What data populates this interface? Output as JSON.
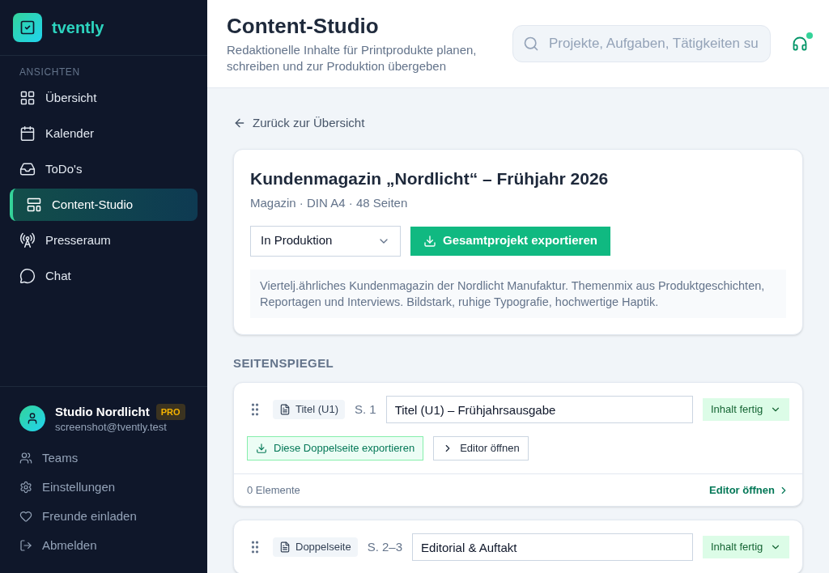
{
  "sidebar": {
    "brand": "tvently",
    "section_label": "ANSICHTEN",
    "items": [
      {
        "label": "Übersicht",
        "selected": false
      },
      {
        "label": "Kalender",
        "selected": false
      },
      {
        "label": "ToDo's",
        "selected": false
      },
      {
        "label": "Content-Studio",
        "selected": true
      },
      {
        "label": "Presseraum",
        "selected": false
      },
      {
        "label": "Chat",
        "selected": false
      }
    ],
    "account": {
      "name": "Studio Nordlicht",
      "badge": "PRO",
      "email": "screenshot@tvently.test"
    },
    "footer_items": [
      {
        "label": "Teams"
      },
      {
        "label": "Einstellungen"
      },
      {
        "label": "Freunde einladen"
      },
      {
        "label": "Abmelden"
      }
    ]
  },
  "header": {
    "title": "Content-Studio",
    "subtitle": "Redaktionelle Inhalte für Printprodukte planen, schreiben und zur Produktion übergeben",
    "search": {
      "placeholder": "Projekte, Aufgaben, Tätigkeiten su"
    }
  },
  "back_link": "Zurück zur Übersicht",
  "project": {
    "title": "Kundenmagazin „Nordlicht“ – Frühjahr 2026",
    "meta": "Magazin · DIN A4 · 48 Seiten",
    "status": "In Produktion",
    "export_button": "Gesamtprojekt exportieren",
    "description": "Viertelj.ährliches Kundenmagazin der Nordlicht Manufaktur. Themenmix aus Produktgeschichten, Reportagen und Interviews. Bildstark, ruhige Typografie, hochwertige Haptik."
  },
  "section_title": "SEITENSPIEGEL",
  "pages": [
    {
      "type": "Titel (U1)",
      "pages": "S. 1",
      "title": "Titel (U1) – Frühjahrsausgabe",
      "status": "Inhalt fertig",
      "export_button": "Diese Doppelseite exportieren",
      "editor_button": "Editor öffnen",
      "element_count": "0 Elemente",
      "footer_link": "Editor öffnen"
    },
    {
      "type": "Doppelseite",
      "pages": "S. 2–3",
      "title": "Editorial & Auftakt",
      "status": "Inhalt fertig"
    }
  ]
}
